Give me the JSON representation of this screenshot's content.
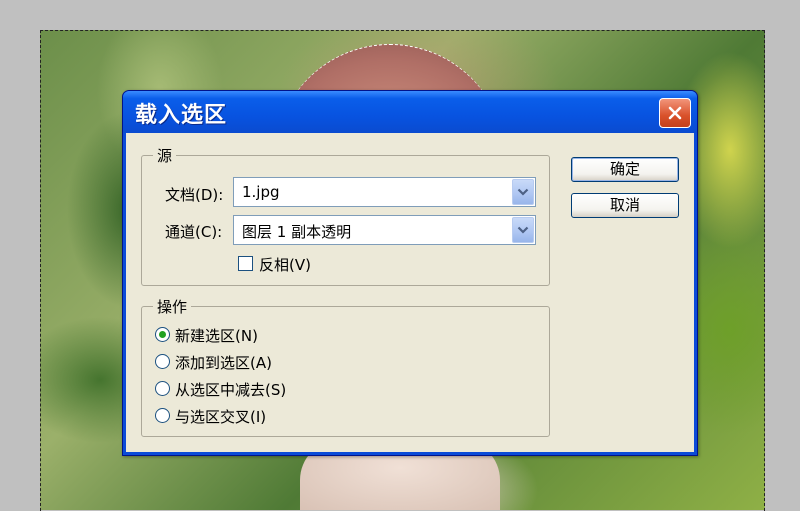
{
  "dialog": {
    "title": "载入选区",
    "source_group": {
      "label": "源",
      "document": {
        "label": "文档(D):",
        "value": "1.jpg"
      },
      "channel": {
        "label": "通道(C):",
        "value": "图层 1 副本透明"
      },
      "invert": {
        "label": "反相(V)",
        "checked": false
      }
    },
    "operation_group": {
      "label": "操作",
      "options": [
        {
          "label": "新建选区(N)",
          "selected": true
        },
        {
          "label": "添加到选区(A)",
          "selected": false
        },
        {
          "label": "从选区中减去(S)",
          "selected": false
        },
        {
          "label": "与选区交叉(I)",
          "selected": false
        }
      ]
    },
    "buttons": {
      "ok": "确定",
      "cancel": "取消"
    }
  },
  "colors": {
    "titlebar": "#0a5eea",
    "client": "#ece9d8",
    "close": "#d9512a",
    "radio_dot": "#21a121"
  },
  "icons": {
    "close": "close-icon",
    "dropdown": "chevron-down-icon"
  }
}
